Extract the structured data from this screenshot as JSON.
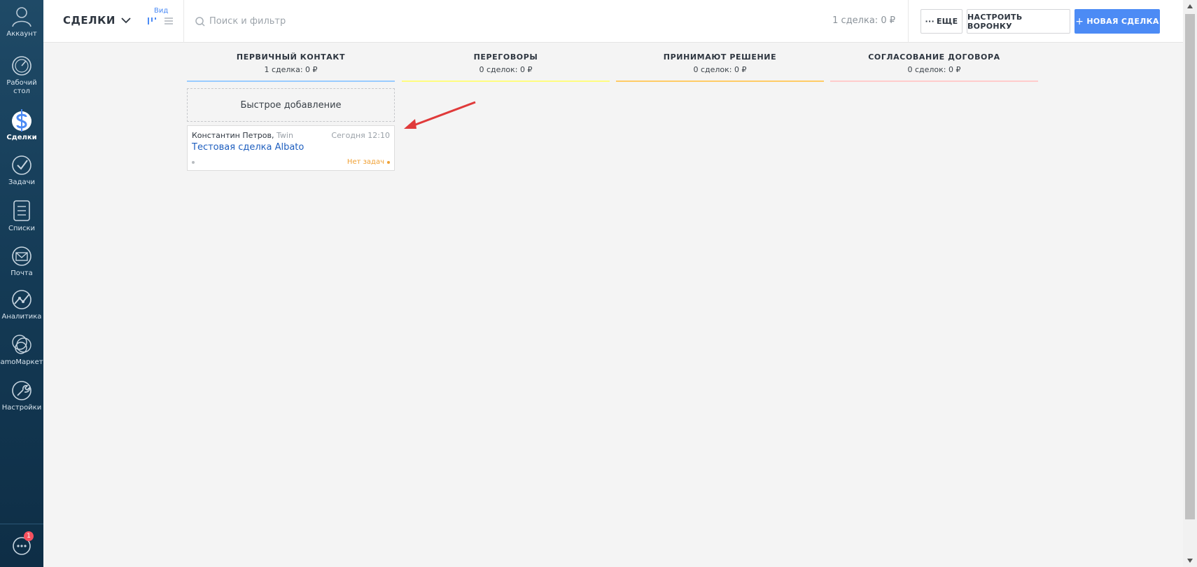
{
  "sidebar": {
    "items": [
      {
        "label": "Аккаунт",
        "icon": "avatar-icon"
      },
      {
        "label": "Рабочий стол",
        "icon": "dashboard-icon"
      },
      {
        "label": "Сделки",
        "icon": "dollar-icon",
        "active": true
      },
      {
        "label": "Задачи",
        "icon": "checkmark-icon"
      },
      {
        "label": "Списки",
        "icon": "list-icon"
      },
      {
        "label": "Почта",
        "icon": "mail-icon"
      },
      {
        "label": "Аналитика",
        "icon": "analytics-icon"
      },
      {
        "label": "amoМаркет",
        "icon": "market-icon"
      },
      {
        "label": "Настройки",
        "icon": "wrench-icon"
      }
    ],
    "chat_badge": "1"
  },
  "header": {
    "title": "СДЕЛКИ",
    "view_label": "Вид",
    "search_placeholder": "Поиск и фильтр",
    "deal_summary": "1 сделка: 0 ₽",
    "more_label": "ЕЩЕ",
    "setup_label": "НАСТРОИТЬ ВОРОНКУ",
    "new_deal_label": "НОВАЯ СДЕЛКА"
  },
  "pipeline": {
    "columns": [
      {
        "name": "ПЕРВИЧНЫЙ КОНТАКТ",
        "count": "1 сделка: 0 ₽",
        "color": "#99ccff"
      },
      {
        "name": "ПЕРЕГОВОРЫ",
        "count": "0 сделок: 0 ₽",
        "color": "#fffd7f"
      },
      {
        "name": "ПРИНИМАЮТ РЕШЕНИЕ",
        "count": "0 сделок: 0 ₽",
        "color": "#ffcc66"
      },
      {
        "name": "СОГЛАСОВАНИЕ ДОГОВОРА",
        "count": "0 сделок: 0 ₽",
        "color": "#ffcccc"
      }
    ],
    "quick_add_label": "Быстрое добавление",
    "card": {
      "contact": "Константин Петров,",
      "company": "Twin",
      "time": "Сегодня 12:10",
      "title": "Тестовая сделка Albato",
      "tasks": "Нет задач"
    }
  },
  "colors": {
    "accent": "#4c8bf5",
    "sidebar": "#1a4361",
    "annotation_arrow": "#e03a3a"
  }
}
